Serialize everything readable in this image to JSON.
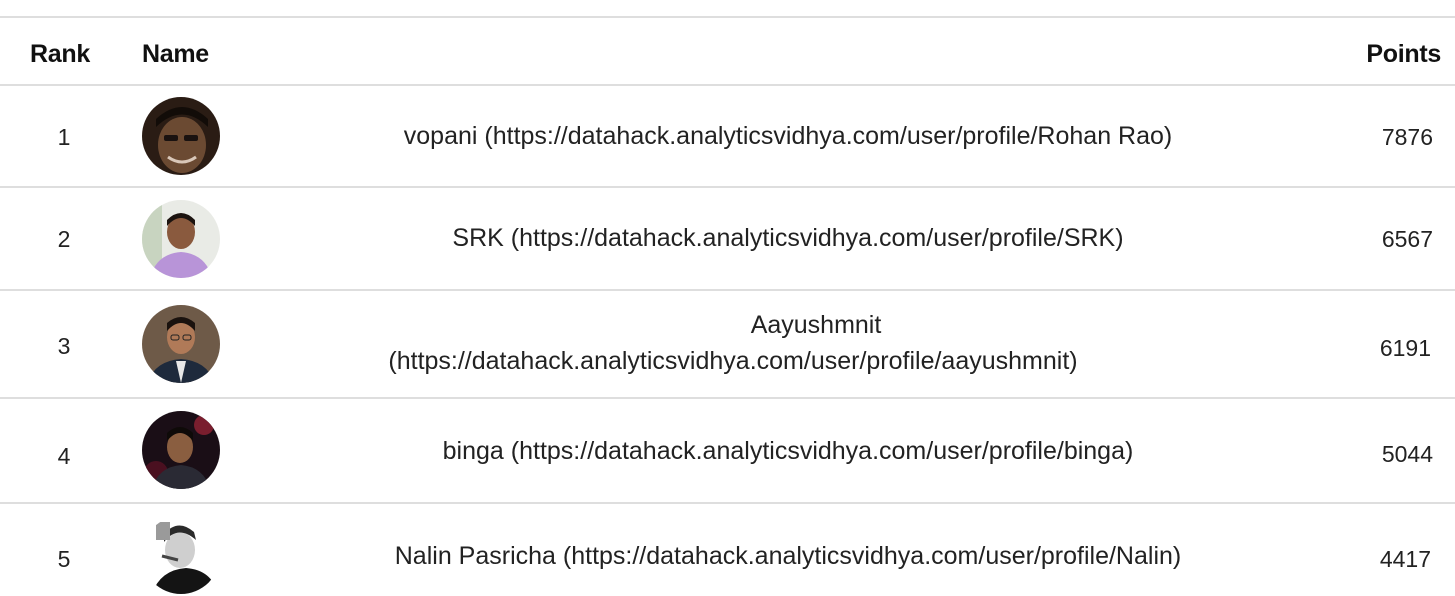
{
  "table": {
    "headers": {
      "rank": "Rank",
      "name": "Name",
      "points": "Points"
    },
    "rows": [
      {
        "rank": "1",
        "name": "vopani",
        "link": "(https://datahack.analyticsvidhya.com/user/profile/Rohan Rao)",
        "points": "7876"
      },
      {
        "rank": "2",
        "name": "SRK",
        "link": "(https://datahack.analyticsvidhya.com/user/profile/SRK)",
        "points": "6567"
      },
      {
        "rank": "3",
        "name": "Aayushmnit",
        "link": "(https://datahack.analyticsvidhya.com/user/profile/aayushmnit)",
        "points": "6191"
      },
      {
        "rank": "4",
        "name": "binga",
        "link": "(https://datahack.analyticsvidhya.com/user/profile/binga)",
        "points": "5044"
      },
      {
        "rank": "5",
        "name": "Nalin Pasricha",
        "link": "(https://datahack.analyticsvidhya.com/user/profile/Nalin)",
        "points": "4417"
      }
    ]
  },
  "colors": {
    "rule": "#dedede",
    "text": "#222222",
    "header_text": "#111111"
  }
}
